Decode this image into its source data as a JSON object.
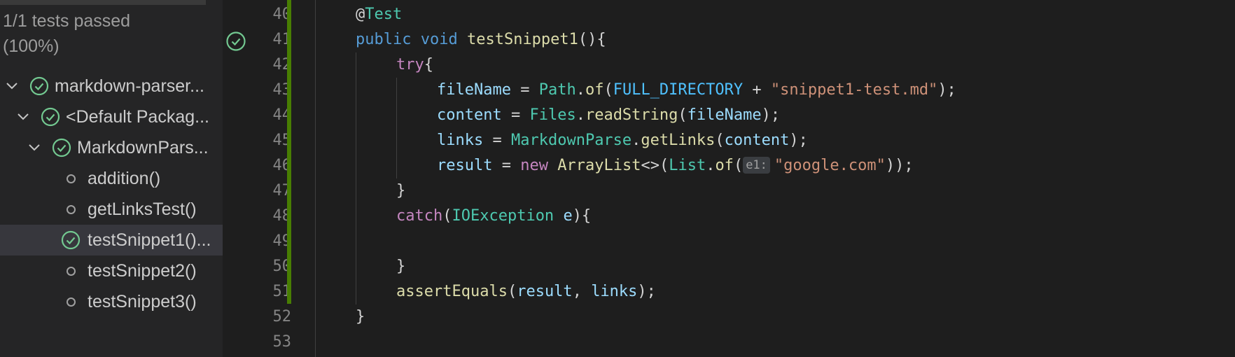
{
  "sidebar": {
    "summary_line1": "1/1 tests passed",
    "summary_line2": "(100%)",
    "tree": [
      {
        "label": "markdown-parser...",
        "status": "passed",
        "expanded": true
      },
      {
        "label": "<Default Packag...",
        "status": "passed",
        "expanded": true
      },
      {
        "label": "MarkdownPars...",
        "status": "passed",
        "expanded": true
      },
      {
        "label": "addition()",
        "status": "not-run"
      },
      {
        "label": "getLinksTest()",
        "status": "not-run"
      },
      {
        "label": "testSnippet1()...",
        "status": "passed",
        "selected": true
      },
      {
        "label": "testSnippet2()",
        "status": "not-run"
      },
      {
        "label": "testSnippet3()",
        "status": "not-run"
      }
    ]
  },
  "editor": {
    "line_numbers": [
      "40",
      "41",
      "42",
      "43",
      "44",
      "45",
      "46",
      "47",
      "48",
      "49",
      "50",
      "51",
      "52",
      "53"
    ],
    "passed_test_line": "41",
    "code": {
      "l40_at": "@",
      "l40_ann": "Test",
      "l41_public": "public",
      "l41_void": "void",
      "l41_name": "testSnippet1",
      "l41_rest": "(){",
      "l42_try": "try",
      "l42_brace": "{",
      "l43_var": "fileName",
      "l43_eq": " = ",
      "l43_path": "Path",
      "l43_dot": ".",
      "l43_of": "of",
      "l43_open": "(",
      "l43_const": "FULL_DIRECTORY",
      "l43_plus": " + ",
      "l43_str": "\"snippet1-test.md\"",
      "l43_close": ");",
      "l44_var": "content",
      "l44_eq": " = ",
      "l44_files": "Files",
      "l44_dot": ".",
      "l44_fn": "readString",
      "l44_open": "(",
      "l44_arg": "fileName",
      "l44_close": ");",
      "l45_var": "links",
      "l45_eq": " = ",
      "l45_cls": "MarkdownParse",
      "l45_dot": ".",
      "l45_fn": "getLinks",
      "l45_open": "(",
      "l45_arg": "content",
      "l45_close": ");",
      "l46_var": "result",
      "l46_eq": " = ",
      "l46_new": "new",
      "l46_cls": "ArrayList",
      "l46_gen": "<>(",
      "l46_list": "List",
      "l46_dot": ".",
      "l46_of": "of",
      "l46_open": "(",
      "l46_hint": "e1:",
      "l46_str": "\"google.com\"",
      "l46_close": "));",
      "l47_brace": "}",
      "l48_catch": "catch",
      "l48_open": "(",
      "l48_type": "IOException",
      "l48_sp": " ",
      "l48_e": "e",
      "l48_close": "){",
      "l50_brace": "}",
      "l51_fn": "assertEquals",
      "l51_open": "(",
      "l51_a1": "result",
      "l51_comma": ", ",
      "l51_a2": "links",
      "l51_close": ");",
      "l52_brace": "}"
    }
  },
  "colors": {
    "keyword": "#569cd6",
    "control": "#c586c0",
    "type": "#4ec9b0",
    "function": "#dcdcaa",
    "variable": "#9cdcfe",
    "constant": "#4fc1ff",
    "string": "#ce9178",
    "pass": "#73c991",
    "gutter_modified": "#487e02"
  }
}
